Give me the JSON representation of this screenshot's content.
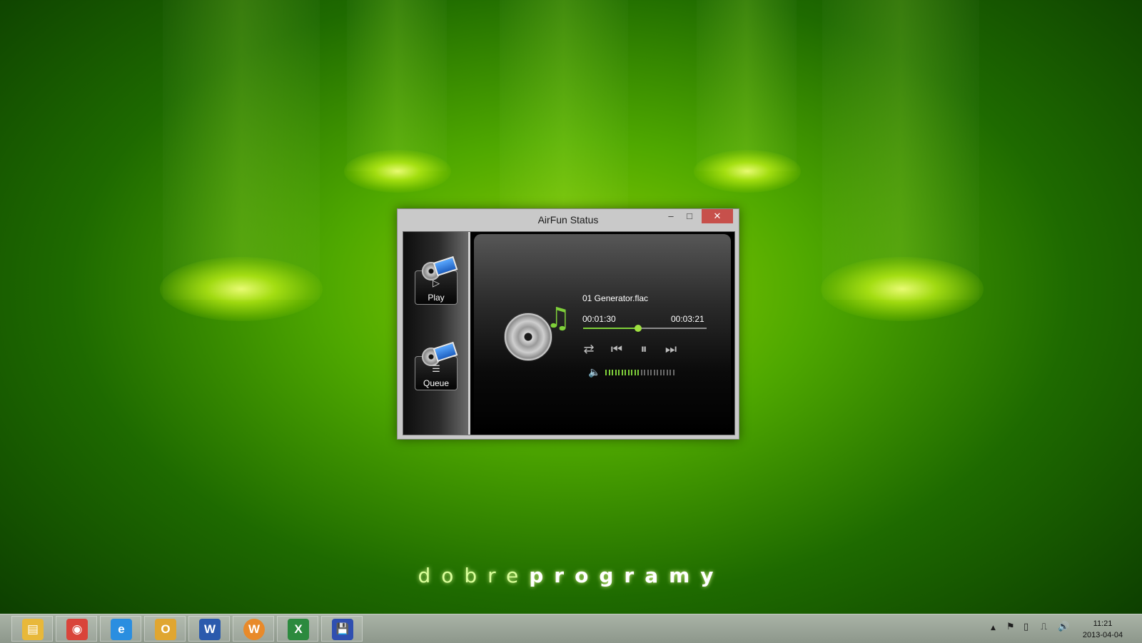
{
  "desktop": {
    "brand_light": "dobre",
    "brand_bold": "programy"
  },
  "window": {
    "title": "AirFun Status",
    "minimize_glyph": "–",
    "maximize_glyph": "□",
    "close_glyph": "✕"
  },
  "sidebar": {
    "items": [
      {
        "label": "Play",
        "glyph": "▷",
        "icon": "play-cd-icon"
      },
      {
        "label": "Queue",
        "glyph": "☰",
        "icon": "queue-cd-icon"
      }
    ]
  },
  "player": {
    "track": "01 Generator.flac",
    "elapsed": "00:01:30",
    "total": "00:03:21",
    "progress_fraction": 0.447,
    "controls": [
      {
        "name": "repeat-off-button",
        "glyph": "⇄",
        "icon": "repeat-off-icon"
      },
      {
        "name": "previous-button",
        "glyph": "⏮",
        "icon": "previous-icon"
      },
      {
        "name": "pause-button",
        "glyph": "⏸",
        "icon": "pause-icon"
      },
      {
        "name": "next-button",
        "glyph": "⏭",
        "icon": "next-icon"
      }
    ],
    "volume": {
      "icon": "speaker-icon",
      "glyph": "🔈",
      "level_segments": 11,
      "total_segments": 22
    },
    "accent_color": "#7fd03a"
  },
  "taskbar": {
    "apps": [
      {
        "name": "file-explorer",
        "glyph": "▤",
        "color": "#e8b83a"
      },
      {
        "name": "chrome",
        "glyph": "◉",
        "color": "#d9443a"
      },
      {
        "name": "internet-explorer",
        "glyph": "e",
        "color": "#2a8ee0"
      },
      {
        "name": "outlook",
        "glyph": "O",
        "color": "#e0a630"
      },
      {
        "name": "word",
        "glyph": "W",
        "color": "#2b5aad"
      },
      {
        "name": "wisdom-app",
        "glyph": "W",
        "color": "#e88a2a"
      },
      {
        "name": "excel",
        "glyph": "X",
        "color": "#2c8a3e"
      },
      {
        "name": "save-app",
        "glyph": "💾",
        "color": "#2f4fb0"
      }
    ],
    "tray": {
      "overflow_glyph": "▲",
      "flag_glyph": "⚑",
      "power_glyph": "▯",
      "network_glyph": "⎍",
      "volume_glyph": "🔊"
    },
    "clock_time": "11:21",
    "clock_date": "2013-04-04"
  }
}
